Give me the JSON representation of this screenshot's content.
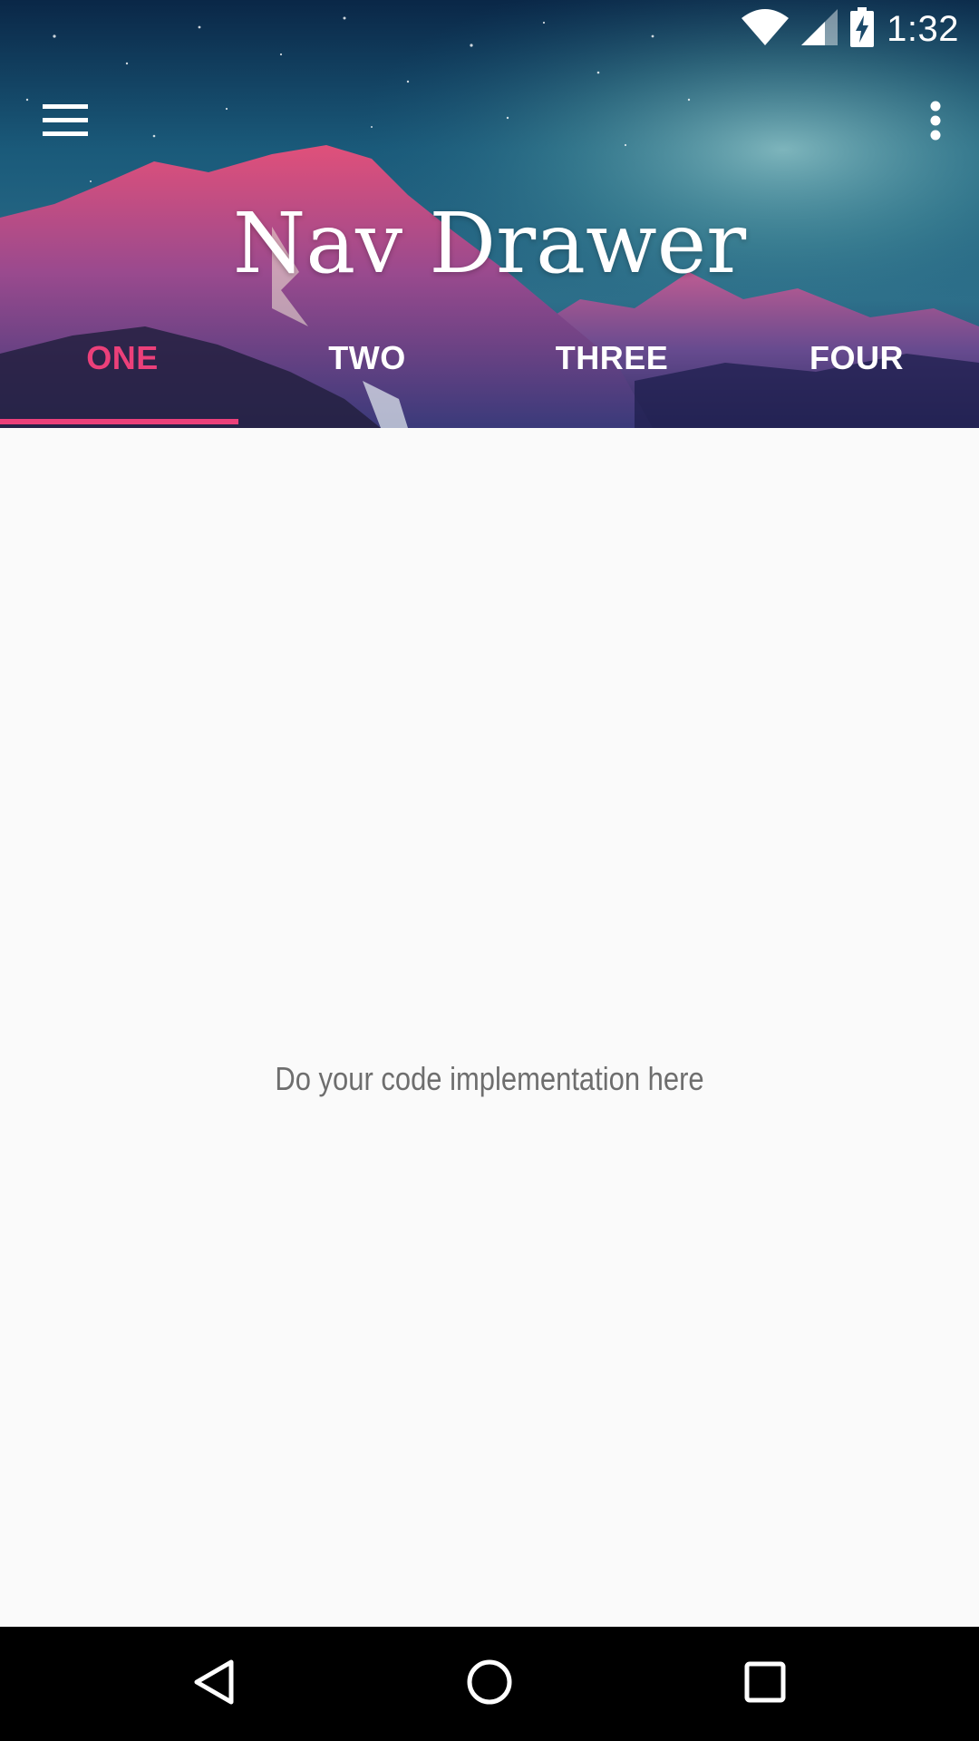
{
  "status_bar": {
    "time": "1:32",
    "icons": [
      "wifi-icon",
      "cell-signal-icon",
      "battery-charging-icon"
    ]
  },
  "toolbar": {
    "title": "Nav Drawer",
    "menu_icon": "hamburger-menu-icon",
    "overflow_icon": "more-vert-icon"
  },
  "tabs": [
    {
      "label": "ONE",
      "active": true
    },
    {
      "label": "TWO",
      "active": false
    },
    {
      "label": "THREE",
      "active": false
    },
    {
      "label": "FOUR",
      "active": false
    }
  ],
  "content": {
    "text": "Do your code implementation here"
  },
  "nav_bar": {
    "icons": [
      "back-icon",
      "home-icon",
      "recents-icon"
    ]
  },
  "colors": {
    "accent": "#ec407a",
    "content_background": "#fafafa",
    "content_text": "#6e6e6e",
    "nav_bar": "#000000"
  }
}
